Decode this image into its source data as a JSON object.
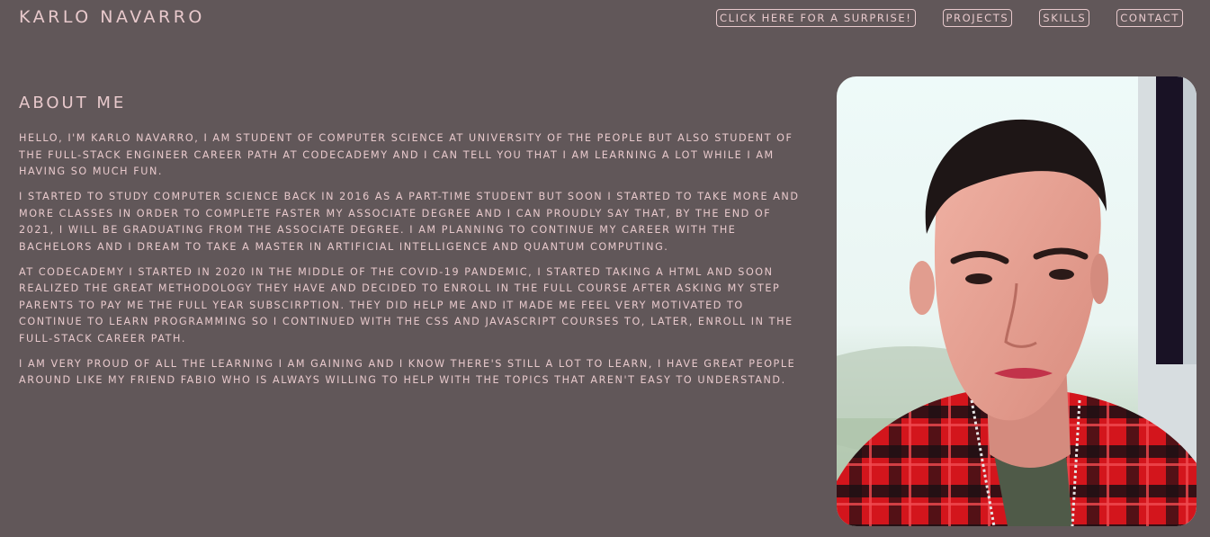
{
  "header": {
    "site_title": "Karlo Navarro",
    "nav": {
      "surprise": "Click here for a surprise!",
      "projects": "Projects",
      "skills": "Skills",
      "contact": "Contact"
    }
  },
  "about": {
    "heading": "About me",
    "paragraphs": [
      "Hello, I'm Karlo Navarro, I am student of Computer Science at University of the People but also student of the Full-Stack Engineer Career Path at Codecademy and I can tell you that I am learning a lot while I am having so much fun.",
      "I started to study Computer Science back in 2016 as a part-time student but soon I started to take more and more classes in order to complete faster my associate degree and I can proudly say that, by the end of 2021, I will be graduating from the associate degree. I am planning to continue my career with the bachelors and I dream to take a master in Artificial Intelligence and Quantum Computing.",
      "At Codecademy I started in 2020 in the middle of the COVID-19 pandemic, I started taking a HTML and soon realized the great methodology they have and decided to enroll in the full course after asking my step parents to pay me the full year subscirption. They did help me and it made me feel very motivated to continue to learn programming so I continued with the CSS and JavaScript courses to, later, enroll in the Full-Stack Career Path.",
      "I am very proud of all the learning I am gaining and I know there's still a lot to learn, I have great people around like my friend Fabio who is always willing to help with the topics that aren't easy to understand."
    ]
  },
  "colors": {
    "background": "#615759",
    "text": "#e8c9cc"
  }
}
